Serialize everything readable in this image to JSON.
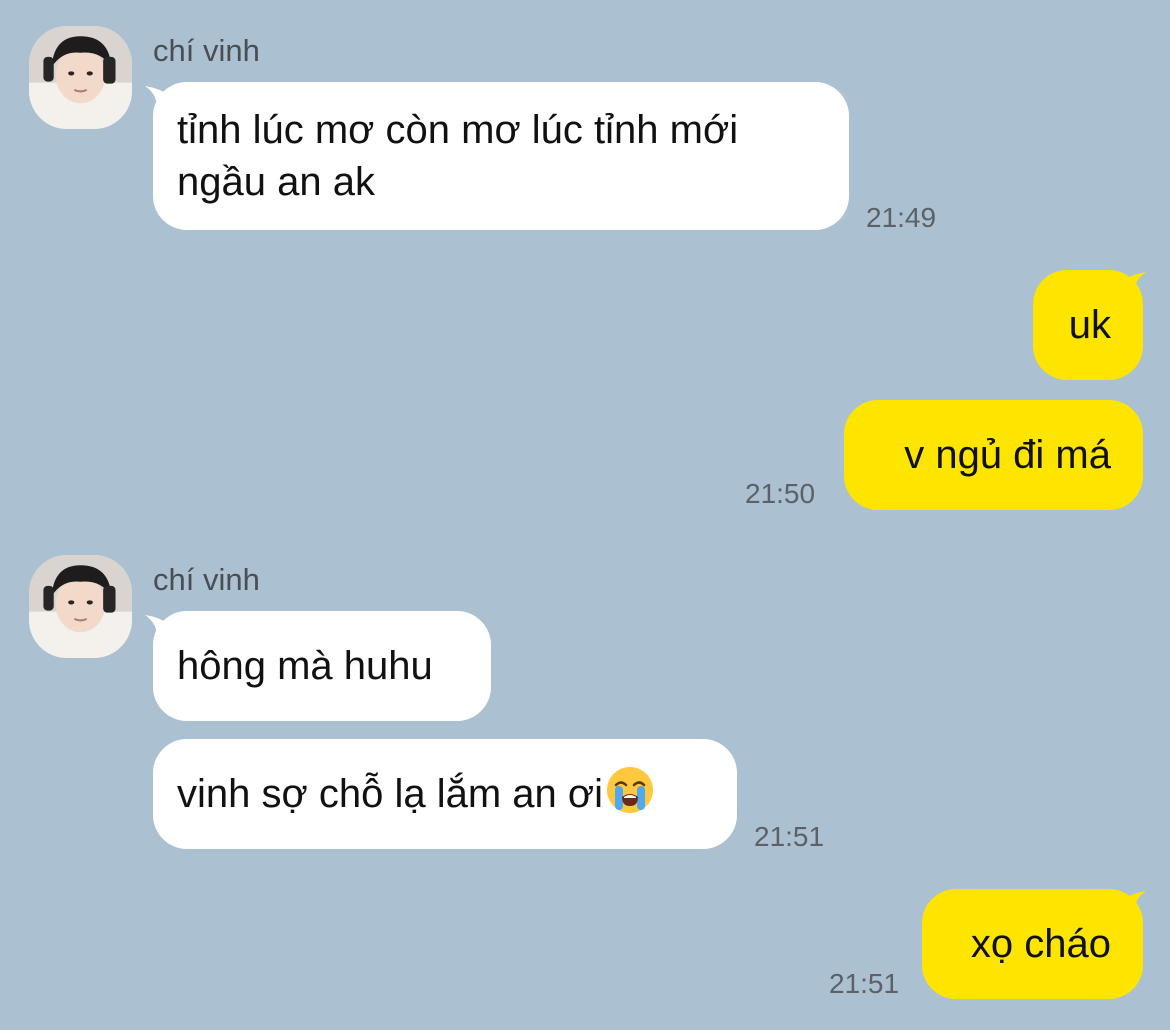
{
  "colors": {
    "background": "#abc1d1",
    "incoming_bubble": "#ffffff",
    "outgoing_bubble": "#fee500",
    "sender_name": "#4a4e53",
    "timestamp": "#5b6167"
  },
  "group1": {
    "sender": "chí vinh",
    "message1": {
      "line1": "tỉnh lúc mơ còn mơ lúc tỉnh mới",
      "line2": "ngầu an ak"
    },
    "time": "21:49"
  },
  "outgoing1": {
    "message1": "uk",
    "message2": "v ngủ đi má",
    "time": "21:50"
  },
  "group2": {
    "sender": "chí vinh",
    "message1": "hông mà huhu",
    "message2": "vinh sợ chỗ lạ lắm an ơi",
    "message2_emoji": "loudly-crying-face-icon",
    "time": "21:51"
  },
  "outgoing2": {
    "message1": "xọ cháo",
    "time": "21:51"
  }
}
